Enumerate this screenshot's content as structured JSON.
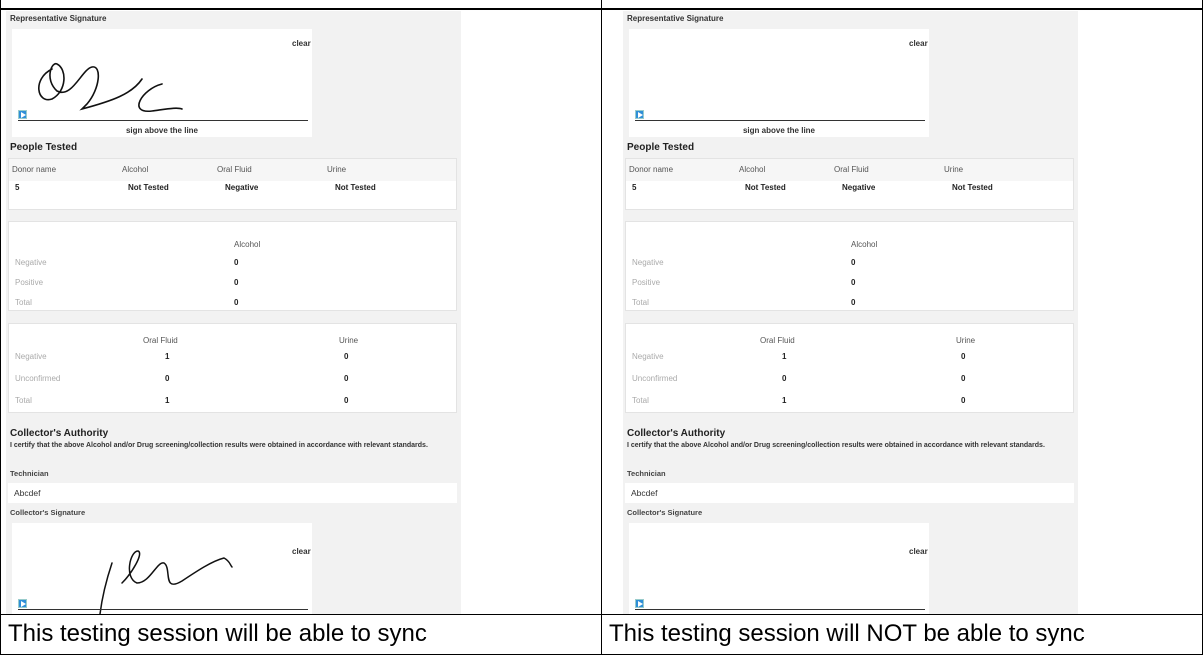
{
  "left": {
    "rep_sig_label": "Representative Signature",
    "clear_label": "clear",
    "sign_caption": "sign above the line",
    "people_tested_title": "People Tested",
    "people_headers": [
      "Donor name",
      "Alcohol",
      "Oral Fluid",
      "Urine"
    ],
    "people_row": [
      "5",
      "Not Tested",
      "Negative",
      "Not Tested"
    ],
    "alcohol_header": "Alcohol",
    "alcohol_rows": [
      {
        "label": "Negative",
        "value": "0"
      },
      {
        "label": "Positive",
        "value": "0"
      },
      {
        "label": "Total",
        "value": "0"
      }
    ],
    "of_header": "Oral Fluid",
    "urine_header": "Urine",
    "drug_rows": [
      {
        "label": "Negative",
        "of": "1",
        "urine": "0"
      },
      {
        "label": "Unconfirmed",
        "of": "0",
        "urine": "0"
      },
      {
        "label": "Total",
        "of": "1",
        "urine": "0"
      }
    ],
    "collector_title": "Collector's Authority",
    "cert_text": "I certify that the above Alcohol and/or Drug screening/collection results were obtained in accordance with relevant standards.",
    "technician_label": "Technician",
    "technician_value": "Abcdef",
    "collector_sig_label": "Collector's Signature",
    "caption": "This testing session will be able to sync"
  },
  "right": {
    "rep_sig_label": "Representative Signature",
    "clear_label": "clear",
    "sign_caption": "sign above the line",
    "people_tested_title": "People Tested",
    "people_headers": [
      "Donor name",
      "Alcohol",
      "Oral Fluid",
      "Urine"
    ],
    "people_row": [
      "5",
      "Not Tested",
      "Negative",
      "Not Tested"
    ],
    "alcohol_header": "Alcohol",
    "alcohol_rows": [
      {
        "label": "Negative",
        "value": "0"
      },
      {
        "label": "Positive",
        "value": "0"
      },
      {
        "label": "Total",
        "value": "0"
      }
    ],
    "of_header": "Oral Fluid",
    "urine_header": "Urine",
    "drug_rows": [
      {
        "label": "Negative",
        "of": "1",
        "urine": "0"
      },
      {
        "label": "Unconfirmed",
        "of": "0",
        "urine": "0"
      },
      {
        "label": "Total",
        "of": "1",
        "urine": "0"
      }
    ],
    "collector_title": "Collector's Authority",
    "cert_text": "I certify that the above Alcohol and/or Drug screening/collection results were obtained in accordance with relevant standards.",
    "technician_label": "Technician",
    "technician_value": "Abcdef",
    "collector_sig_label": "Collector's Signature",
    "caption": "This testing session will NOT be able to sync"
  },
  "colors": {
    "play_icon": "#2f8fd8",
    "panel_bg": "#f2f2f2"
  }
}
